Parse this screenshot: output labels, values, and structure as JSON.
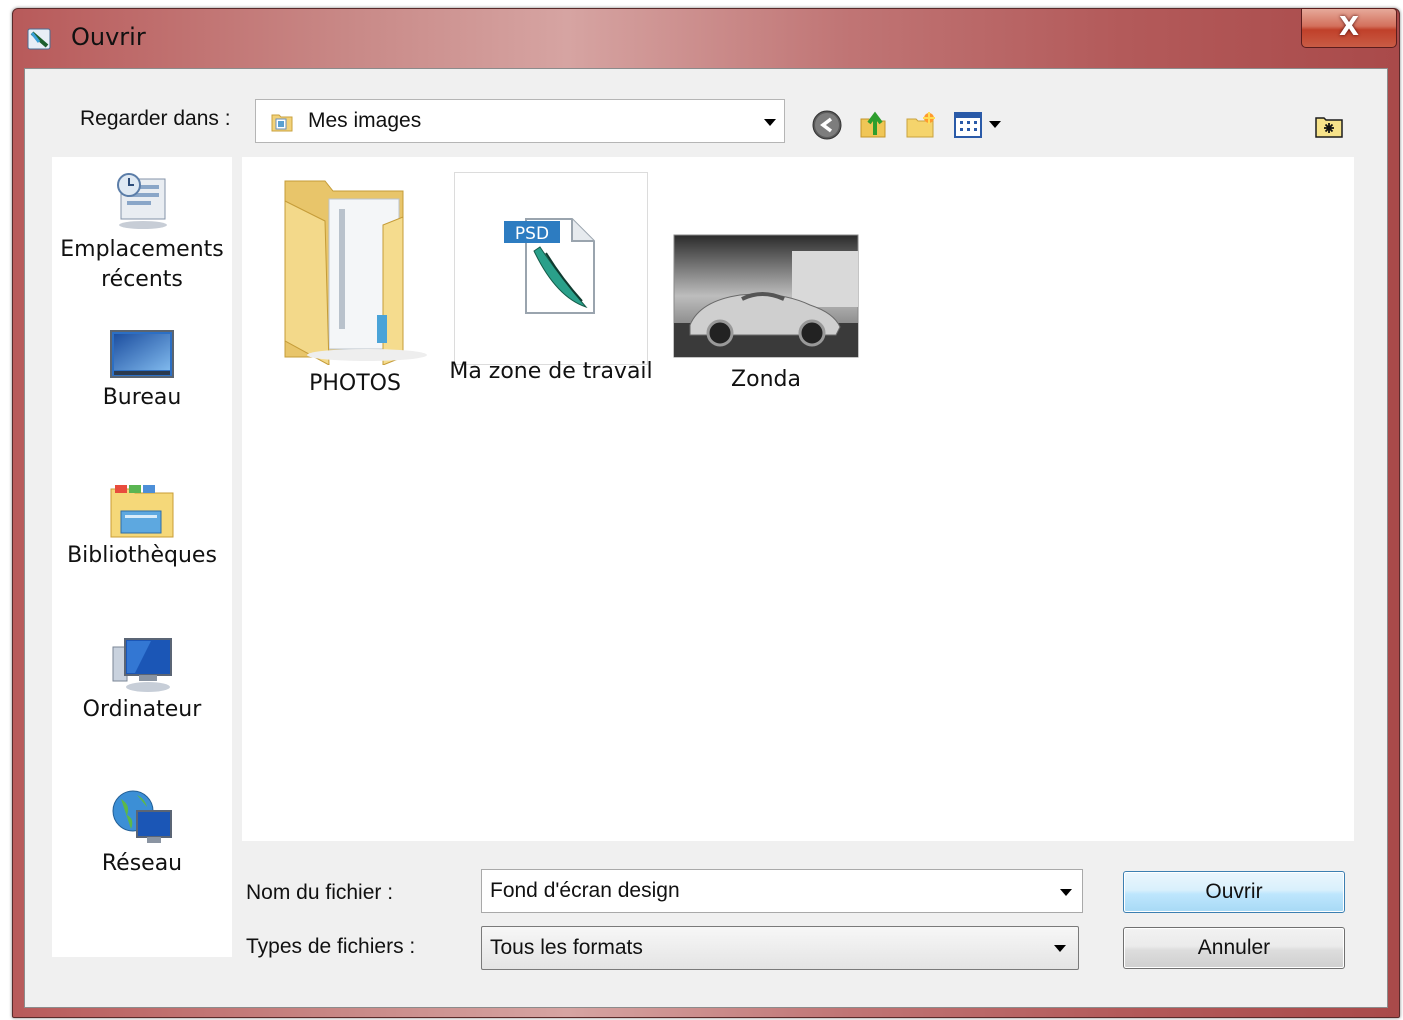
{
  "window": {
    "title": "Ouvrir",
    "close_label": "X"
  },
  "toolbar": {
    "look_in_label": "Regarder dans :",
    "look_in_value": "Mes images",
    "icons": [
      "back-icon",
      "up-folder-icon",
      "new-folder-icon",
      "view-menu-icon",
      "bridge-icon"
    ]
  },
  "places": [
    {
      "label_line1": "Emplacements",
      "label_line2": "récents",
      "icon": "recent-places-icon"
    },
    {
      "label_line1": "Bureau",
      "label_line2": "",
      "icon": "desktop-icon"
    },
    {
      "label_line1": "Bibliothèques",
      "label_line2": "",
      "icon": "libraries-icon"
    },
    {
      "label_line1": "Ordinateur",
      "label_line2": "",
      "icon": "computer-icon"
    },
    {
      "label_line1": "Réseau",
      "label_line2": "",
      "icon": "network-icon"
    }
  ],
  "files": [
    {
      "name": "PHOTOS",
      "icon": "folder-icon"
    },
    {
      "name": "Ma zone de travail",
      "icon": "psd-file-icon",
      "badge": "PSD"
    },
    {
      "name": "Zonda",
      "icon": "image-thumbnail"
    }
  ],
  "form": {
    "filename_label": "Nom du fichier :",
    "filename_value": "Fond d'écran design",
    "filetype_label": "Types de fichiers :",
    "filetype_value": "Tous les formats",
    "open_label": "Ouvrir",
    "cancel_label": "Annuler"
  },
  "colors": {
    "title_bar": "#b85a5a",
    "client_bg": "#f0f0f0",
    "open_border": "#3c7fb1"
  }
}
